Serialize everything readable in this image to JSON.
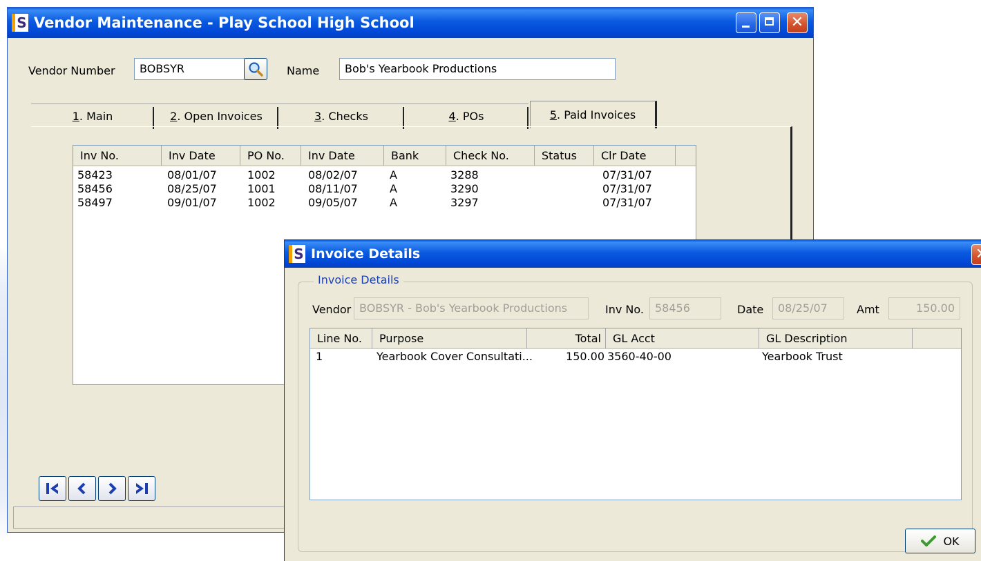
{
  "main_window": {
    "title": "Vendor Maintenance - Play School High School",
    "app_icon": "S",
    "vendor_number_label": "Vendor Number",
    "vendor_number_value": "BOBSYR",
    "name_label": "Name",
    "name_value": "Bob's Yearbook Productions",
    "tabs": [
      {
        "key": "1",
        "label": ". Main"
      },
      {
        "key": "2",
        "label": ". Open Invoices"
      },
      {
        "key": "3",
        "label": ". Checks"
      },
      {
        "key": "4",
        "label": ". POs"
      },
      {
        "key": "5",
        "label": ". Paid Invoices"
      }
    ],
    "active_tab": 4,
    "paid_invoices": {
      "columns": [
        "Inv No.",
        "Inv Date",
        "PO No.",
        "Inv Date",
        "Bank",
        "Check No.",
        "Status",
        "Clr Date"
      ],
      "rows": [
        [
          "58423",
          "08/01/07",
          "1002",
          "08/02/07",
          "A",
          "3288",
          "",
          "07/31/07"
        ],
        [
          "58456",
          "08/25/07",
          "1001",
          "08/11/07",
          "A",
          "3290",
          "",
          "07/31/07"
        ],
        [
          "58497",
          "09/01/07",
          "1002",
          "09/05/07",
          "A",
          "3297",
          "",
          "07/31/07"
        ]
      ]
    }
  },
  "dialog": {
    "title": "Invoice Details",
    "app_icon": "S",
    "group_title": "Invoice Details",
    "vendor_label": "Vendor",
    "vendor_value": "BOBSYR - Bob's Yearbook Productions",
    "inv_no_label": "Inv No.",
    "inv_no_value": "58456",
    "date_label": "Date",
    "date_value": "08/25/07",
    "amt_label": "Amt",
    "amt_value": "150.00",
    "lines": {
      "columns": [
        "Line No.",
        "Purpose",
        "Total",
        "GL Acct",
        "GL Description"
      ],
      "rows": [
        [
          "1",
          "Yearbook Cover Consultati...",
          "150.00",
          "3560-40-00",
          "Yearbook Trust"
        ]
      ]
    },
    "ok_label": "OK"
  },
  "colors": {
    "titlebar": "#0a5ae0",
    "window_face": "#ece9d8",
    "nav_arrow": "#1c3fb0",
    "ok_check": "#3c9a2e"
  }
}
